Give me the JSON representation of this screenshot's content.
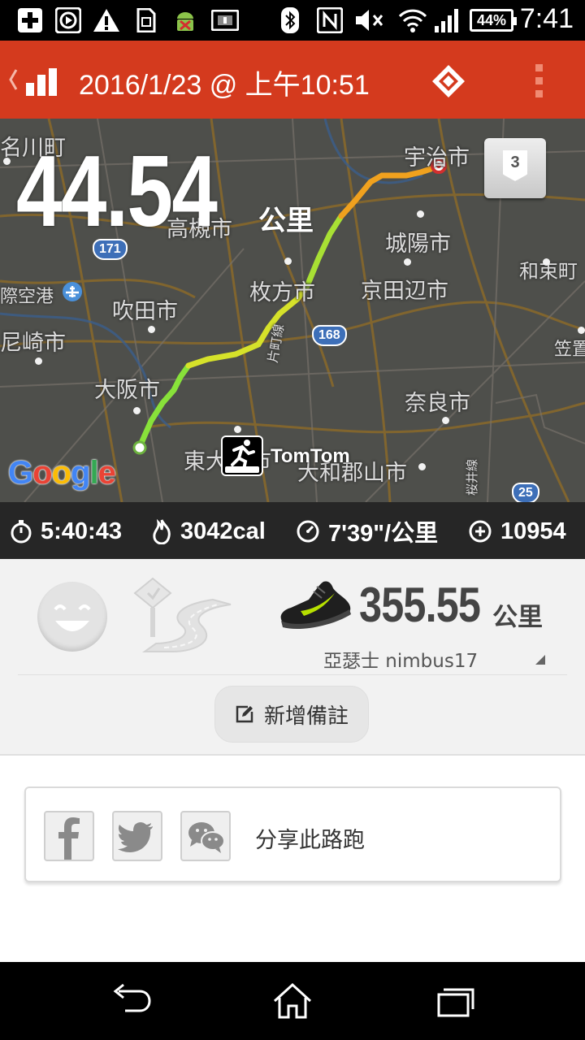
{
  "status_bar": {
    "battery": "44%",
    "time": "7:41",
    "icons": [
      "plus-icon",
      "circle-play-icon",
      "warning-icon",
      "sim-icon",
      "android-debug-icon",
      "info-card-icon",
      "bluetooth-icon",
      "nfc-icon",
      "mute-icon",
      "wifi-icon",
      "signal-icon",
      "battery-icon"
    ]
  },
  "app_bar": {
    "title": "2016/1/23 @ 上午10:51",
    "icons": [
      "back-chevron-icon",
      "bar-chart-icon",
      "diamond-icon",
      "overflow-menu-icon"
    ]
  },
  "map": {
    "distance": "44.54",
    "distance_unit": "公里",
    "level_badge": "3",
    "labels": {
      "ujishi": "宇治市",
      "takatsuki": "高槻市",
      "joyo": "城陽市",
      "wazuka": "和束町",
      "kawa": "名川町",
      "hirakata": "枚方市",
      "kyotanabe": "京田辺市",
      "airport": "際空港",
      "suita": "吹田市",
      "amagasaki": "尼崎市",
      "osaka": "大阪市",
      "nara": "奈良市",
      "higashiosaka": "東大阪市",
      "yamatokoriyama": "大和郡山市",
      "katamachi_line": "片町線",
      "sakurai_line": "桜井線",
      "kasagi": "笠置"
    },
    "road_shields": [
      "171",
      "168",
      "25"
    ],
    "google_logo": "Google",
    "tomtom_label": "TomTom",
    "route_colors": [
      "#88e23a",
      "#d6e22a",
      "#f0a11e"
    ]
  },
  "stats": {
    "duration": "5:40:43",
    "calories": "3042cal",
    "pace": "7'39\"/公里",
    "steps": "10954"
  },
  "gear": {
    "shoe_distance": "355.55",
    "shoe_distance_unit": "公里",
    "shoe_name": "亞瑟士 nimbus17",
    "add_note_label": "新增備註"
  },
  "share": {
    "label": "分享此路跑",
    "icons": [
      "facebook-icon",
      "twitter-icon",
      "wechat-icon"
    ]
  },
  "nav": {
    "icons": [
      "back-icon",
      "home-icon",
      "recents-icon"
    ]
  }
}
